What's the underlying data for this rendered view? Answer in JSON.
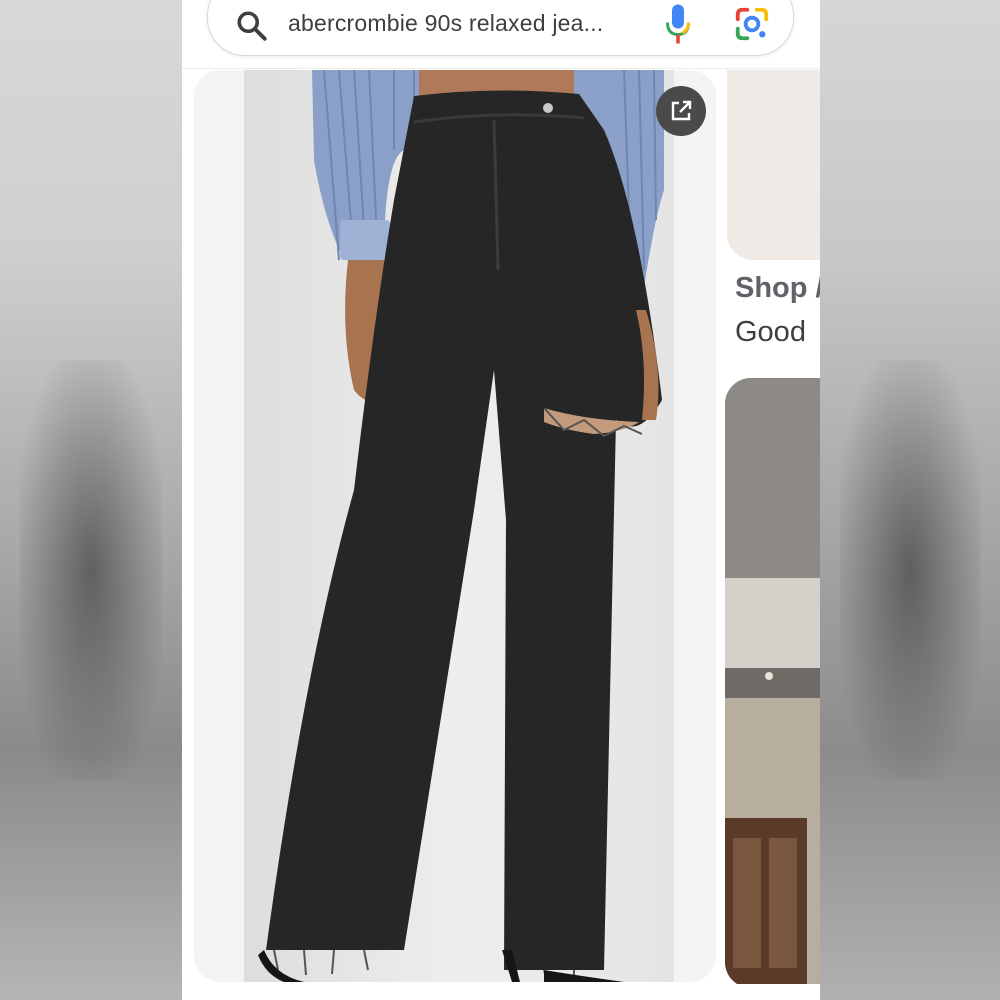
{
  "search": {
    "query": "abercrombie 90s relaxed jea..."
  },
  "results": {
    "caption_line1": "Shop /",
    "caption_line2": "Good"
  },
  "icons": {
    "search": "search-icon",
    "mic": "mic-icon",
    "lens": "google-lens-icon",
    "open_external": "open-in-new-icon"
  },
  "colors": {
    "mic_blue": "#4285f4",
    "mic_red": "#ea4335",
    "lens_green": "#34a853",
    "lens_yellow": "#fbbc04"
  }
}
